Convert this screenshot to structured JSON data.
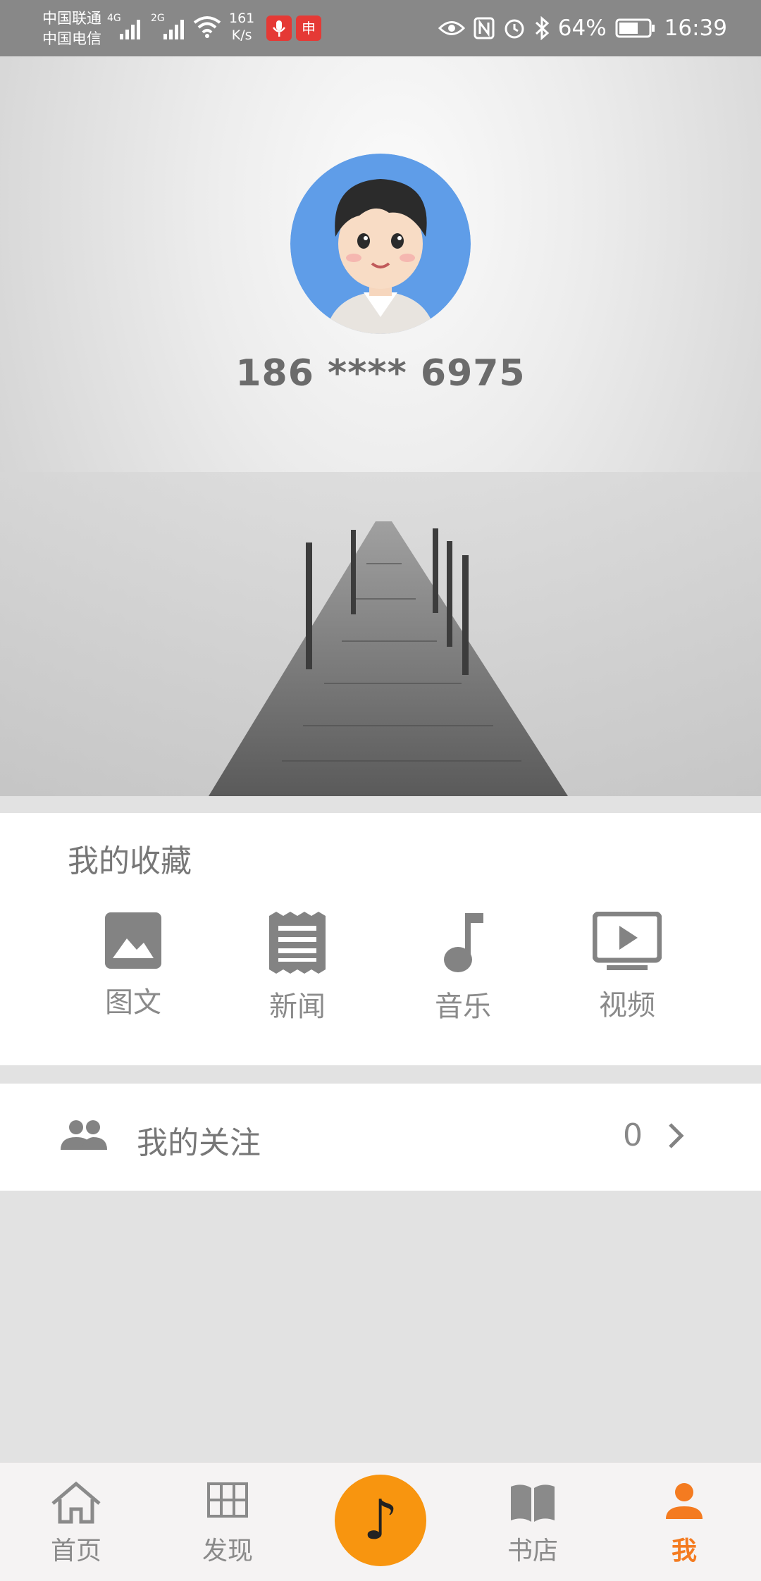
{
  "status_bar": {
    "carrier_1": "中国联通",
    "carrier_2": "中国电信",
    "net_1": "4G",
    "net_2": "2G",
    "speed_value": "161",
    "speed_unit": "K/s",
    "badge_app": "申",
    "battery": "64%",
    "time": "16:39"
  },
  "profile": {
    "phone": "186 **** 6975"
  },
  "favorites": {
    "title": "我的收藏",
    "items": [
      {
        "label": "图文",
        "icon": "image-icon"
      },
      {
        "label": "新闻",
        "icon": "news-icon"
      },
      {
        "label": "音乐",
        "icon": "music-note-icon"
      },
      {
        "label": "视频",
        "icon": "video-icon"
      }
    ]
  },
  "follow": {
    "label": "我的关注",
    "count": "0"
  },
  "nav": {
    "items": [
      {
        "label": "首页",
        "icon": "home-icon"
      },
      {
        "label": "发现",
        "icon": "grid-icon"
      },
      {
        "label": "",
        "icon": "music-note-icon"
      },
      {
        "label": "书店",
        "icon": "book-icon"
      },
      {
        "label": "我",
        "icon": "person-icon"
      }
    ],
    "center_symbol": "♪",
    "active_color": "#f47b20",
    "center_color": "#f8950f"
  }
}
